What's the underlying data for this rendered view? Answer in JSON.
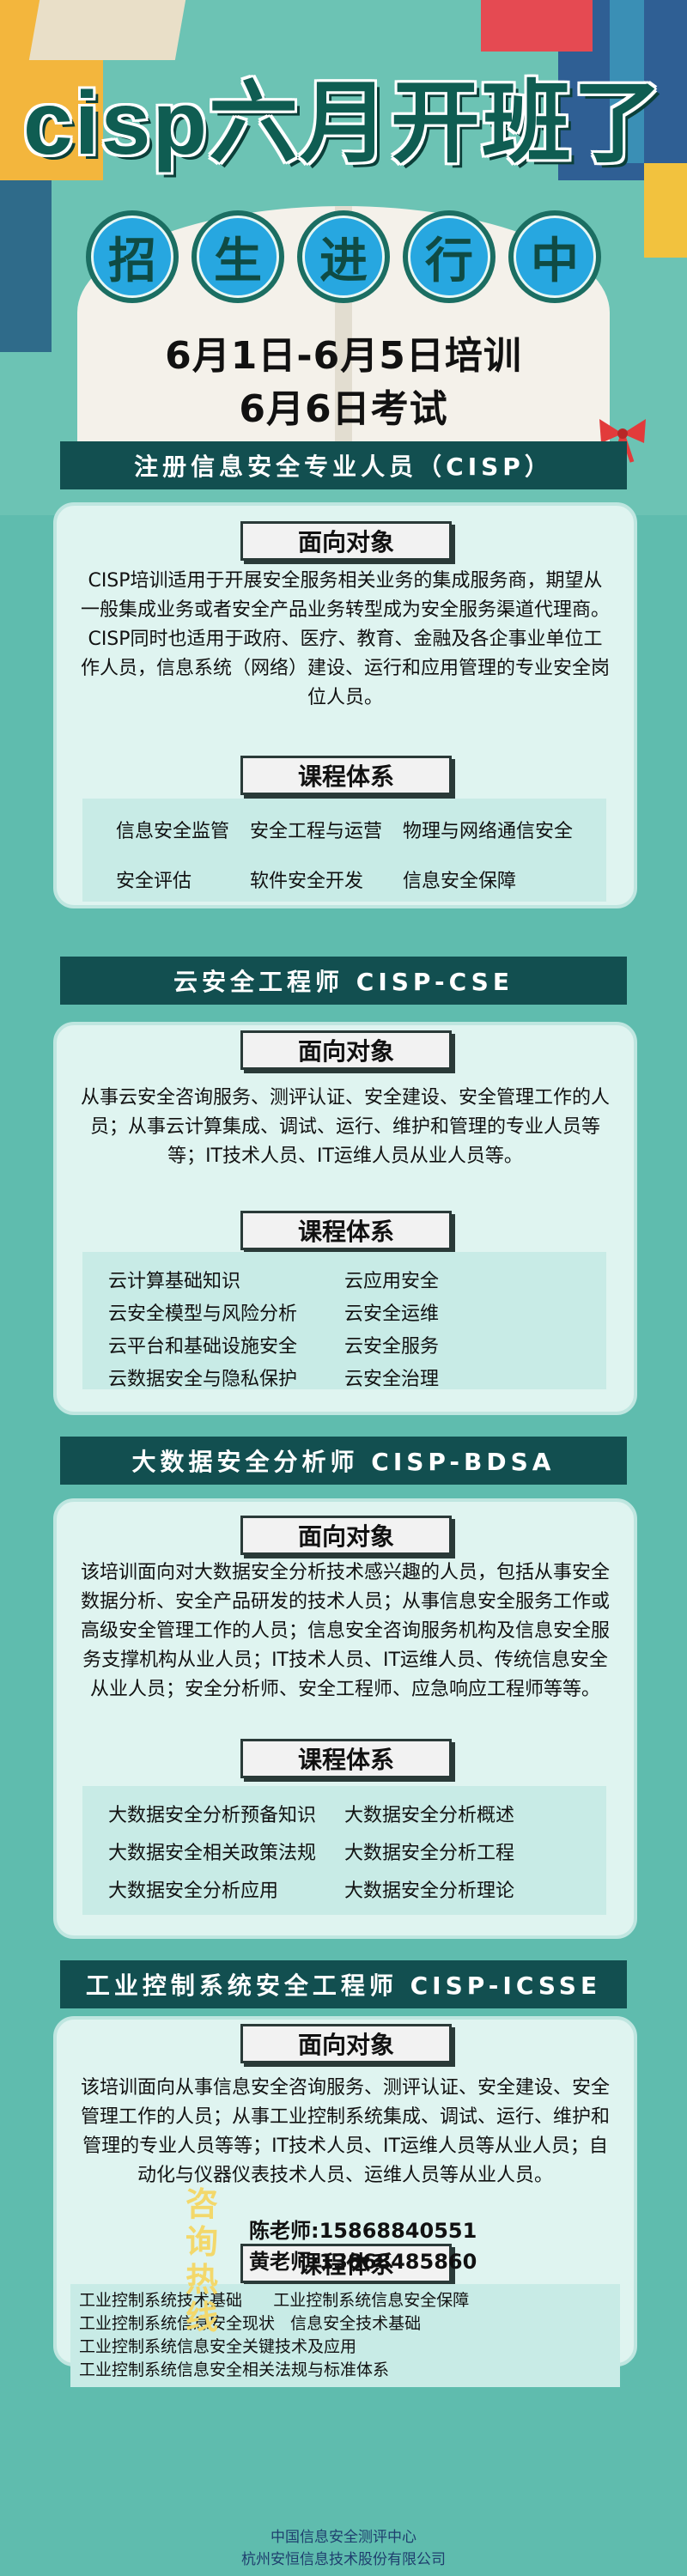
{
  "header": {
    "title": "cisp六月开班了",
    "circles": [
      "招",
      "生",
      "进",
      "行",
      "中"
    ],
    "date_line1": "6月1日-6月5日培训",
    "date_line2": "6月6日考试"
  },
  "sections": [
    {
      "title": "注册信息安全专业人员（CISP）",
      "audience_label": "面向对象",
      "audience_text": "CISP培训适用于开展安全服务相关业务的集成服务商，期望从一般集成业务或者安全产品业务转型成为安全服务渠道代理商。CISP同时也适用于政府、医疗、教育、金融及各企事业单位工作人员，信息系统（网络）建设、运行和应用管理的专业安全岗位人员。",
      "course_label": "课程体系",
      "courses": [
        "信息安全监管",
        "安全工程与运营",
        "物理与网络通信安全",
        "安全评估",
        "软件安全开发",
        "信息安全保障"
      ]
    },
    {
      "title": "云安全工程师 CISP-CSE",
      "audience_label": "面向对象",
      "audience_text": "从事云安全咨询服务、测评认证、安全建设、安全管理工作的人员；从事云计算集成、调试、运行、维护和管理的专业人员等等；IT技术人员、IT运维人员从业人员等。",
      "course_label": "课程体系",
      "courses": [
        "云计算基础知识",
        "云应用安全",
        "云安全模型与风险分析",
        "云安全运维",
        "云平台和基础设施安全",
        "云安全服务",
        "云数据安全与隐私保护",
        "云安全治理"
      ]
    },
    {
      "title": "大数据安全分析师 CISP-BDSA",
      "audience_label": "面向对象",
      "audience_text": "该培训面向对大数据安全分析技术感兴趣的人员，包括从事安全数据分析、安全产品研发的技术人员；从事信息安全服务工作或高级安全管理工作的人员；信息安全咨询服务机构及信息安全服务支撑机构从业人员；IT技术人员、IT运维人员、传统信息安全从业人员；安全分析师、安全工程师、应急响应工程师等等。",
      "course_label": "课程体系",
      "courses": [
        "大数据安全分析预备知识",
        "大数据安全分析概述",
        "大数据安全相关政策法规",
        "大数据安全分析工程",
        "大数据安全分析应用",
        "大数据安全分析理论"
      ]
    },
    {
      "title": "工业控制系统安全工程师 CISP-ICSSE",
      "audience_label": "面向对象",
      "audience_text": "该培训面向从事信息安全咨询服务、测评认证、安全建设、安全管理工作的人员；从事工业控制系统集成、调试、运行、维护和管理的专业人员等等；IT技术人员、IT运维人员等从业人员；自动化与仪器仪表技术人员、运维人员等从业人员。",
      "course_label": "课程体系",
      "courses": [
        "工业控制系统技术基础",
        "工业控制系统信息安全保障",
        "工业控制系统信息安全现状",
        "信息安全技术基础",
        "工业控制系统信息安全关键技术及应用",
        "工业控制系统信息安全相关法规与标准体系"
      ]
    }
  ],
  "footer": {
    "hotline_label": "咨询热线",
    "contact1": "陈老师:15868840551",
    "contact2": "黄老师:13868485860",
    "org1": "中国信息安全测评中心",
    "org2": "杭州安恒信息技术股份有限公司"
  },
  "colors": {
    "bg": "#5fbcae",
    "bar": "#124f50",
    "card": "#dff4f0",
    "title": "#0f5d52"
  }
}
